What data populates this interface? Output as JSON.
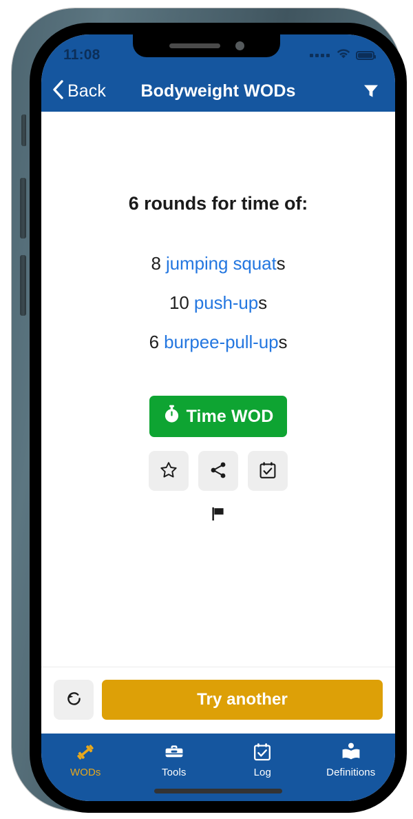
{
  "status_bar": {
    "time": "11:08",
    "signal_icon": "signal-dots-icon",
    "wifi_icon": "wifi-icon",
    "battery_icon": "battery-full-icon"
  },
  "header": {
    "back_label": "Back",
    "back_icon": "chevron-left-icon",
    "title": "Bodyweight WODs",
    "filter_icon": "filter-funnel-icon"
  },
  "workout": {
    "title": "6 rounds for time of:",
    "lines": [
      {
        "count": "8",
        "link": "jumping squat",
        "suffix": "s"
      },
      {
        "count": "10",
        "link": "push-up",
        "suffix": "s"
      },
      {
        "count": "6",
        "link": "burpee-pull-up",
        "suffix": "s"
      }
    ]
  },
  "actions": {
    "time_wod_label": "Time WOD",
    "time_wod_icon": "stopwatch-icon",
    "favorite_icon": "star-outline-icon",
    "share_icon": "share-icon",
    "schedule_icon": "calendar-check-icon",
    "flag_icon": "flag-icon"
  },
  "action_bar": {
    "reset_icon": "rotate-ccw-icon",
    "try_another_label": "Try another"
  },
  "tabs": [
    {
      "label": "WODs",
      "icon": "dumbbell-icon",
      "active": true
    },
    {
      "label": "Tools",
      "icon": "toolbox-icon",
      "active": false
    },
    {
      "label": "Log",
      "icon": "calendar-check-icon",
      "active": false
    },
    {
      "label": "Definitions",
      "icon": "open-book-icon",
      "active": false
    }
  ],
  "colors": {
    "header_blue": "#15569f",
    "link_blue": "#2477e0",
    "green": "#0ea432",
    "orange": "#dda007",
    "tab_active": "#e8a81c"
  }
}
